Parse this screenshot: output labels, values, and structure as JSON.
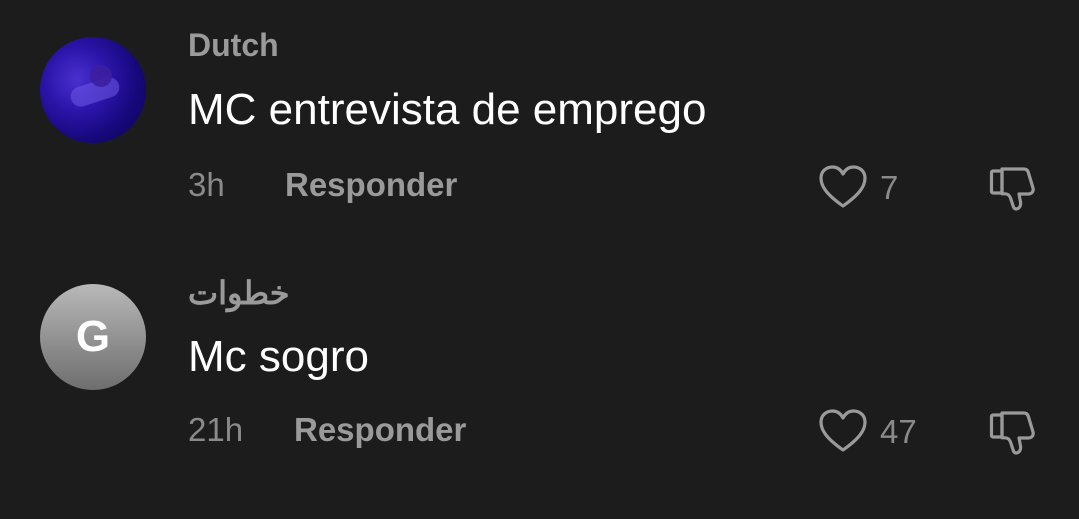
{
  "comments": [
    {
      "username": "Dutch",
      "text": "MC entrevista de emprego",
      "time": "3h",
      "reply_label": "Responder",
      "likes": "7",
      "avatar": {
        "type": "photo",
        "color": "#2a14a8"
      }
    },
    {
      "username": "خطوات",
      "text": "Mc sogro",
      "time": "21h",
      "reply_label": "Responder",
      "likes": "47",
      "avatar": {
        "type": "letter",
        "letter": "G",
        "color": "#9a9a9a"
      }
    }
  ],
  "icons": {
    "like": "heart-outline-icon",
    "dislike": "thumbs-down-outline-icon"
  }
}
